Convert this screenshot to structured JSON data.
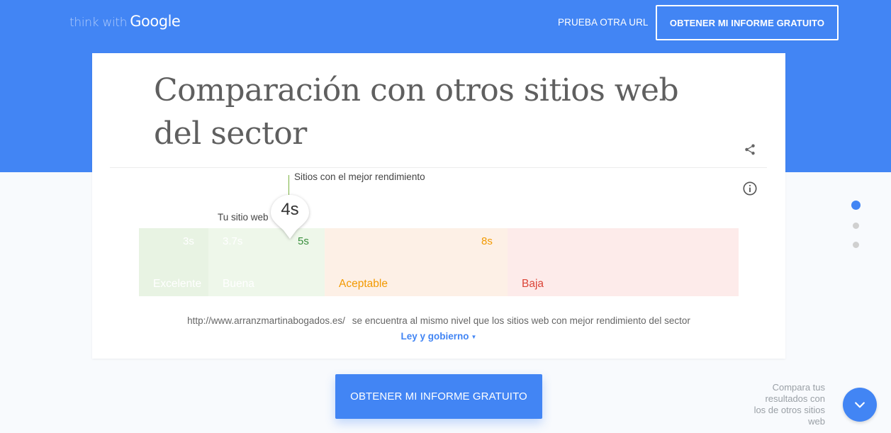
{
  "header": {
    "logo_prefix": "think with",
    "logo_brand": "Google",
    "nav_link": "PRUEBA OTRA URL",
    "nav_cta": "OBTENER MI INFORME GRATUITO"
  },
  "card": {
    "title": "Comparación con otros sitios web del sector",
    "best_label": "Sitios con el mejor rendimiento",
    "your_site_label": "Tu sitio web",
    "your_site_value": "4s",
    "scale": {
      "segments": [
        {
          "label": "Excelente",
          "tick": "3s",
          "color": "#e8f3e3",
          "text_color": "#ffffff"
        },
        {
          "label": "Buena",
          "tick": "3.7s",
          "color": "#eef7ea",
          "text_color": "#ffffff"
        },
        {
          "label": "Aceptable",
          "tick": "5s",
          "color": "#fdf0e6",
          "text_color": "#f29900"
        },
        {
          "label": "Baja",
          "tick": "8s",
          "color": "#fdebea",
          "text_color": "#db4437"
        }
      ],
      "tick_5s_color": "#388e3c",
      "tick_8s_color": "#f29900"
    },
    "summary_url": "http://www.arranzmartinabogados.es/",
    "summary_text": "se encuentra al mismo nivel que los sitios web con mejor rendimiento del sector",
    "sector_dropdown": "Ley y gobierno",
    "sector_caret": "▼"
  },
  "main_cta": "OBTENER MI INFORME GRATUITO",
  "pagination": {
    "count": 3,
    "active_index": 0
  },
  "compare_text": "Compara tus resultados con los de otros sitios web",
  "icons": {
    "share": "share-icon",
    "info": "info-icon",
    "scroll": "chevron-down-icon"
  },
  "colors": {
    "brand_blue": "#4285f4",
    "best_line": "#7cb342"
  }
}
